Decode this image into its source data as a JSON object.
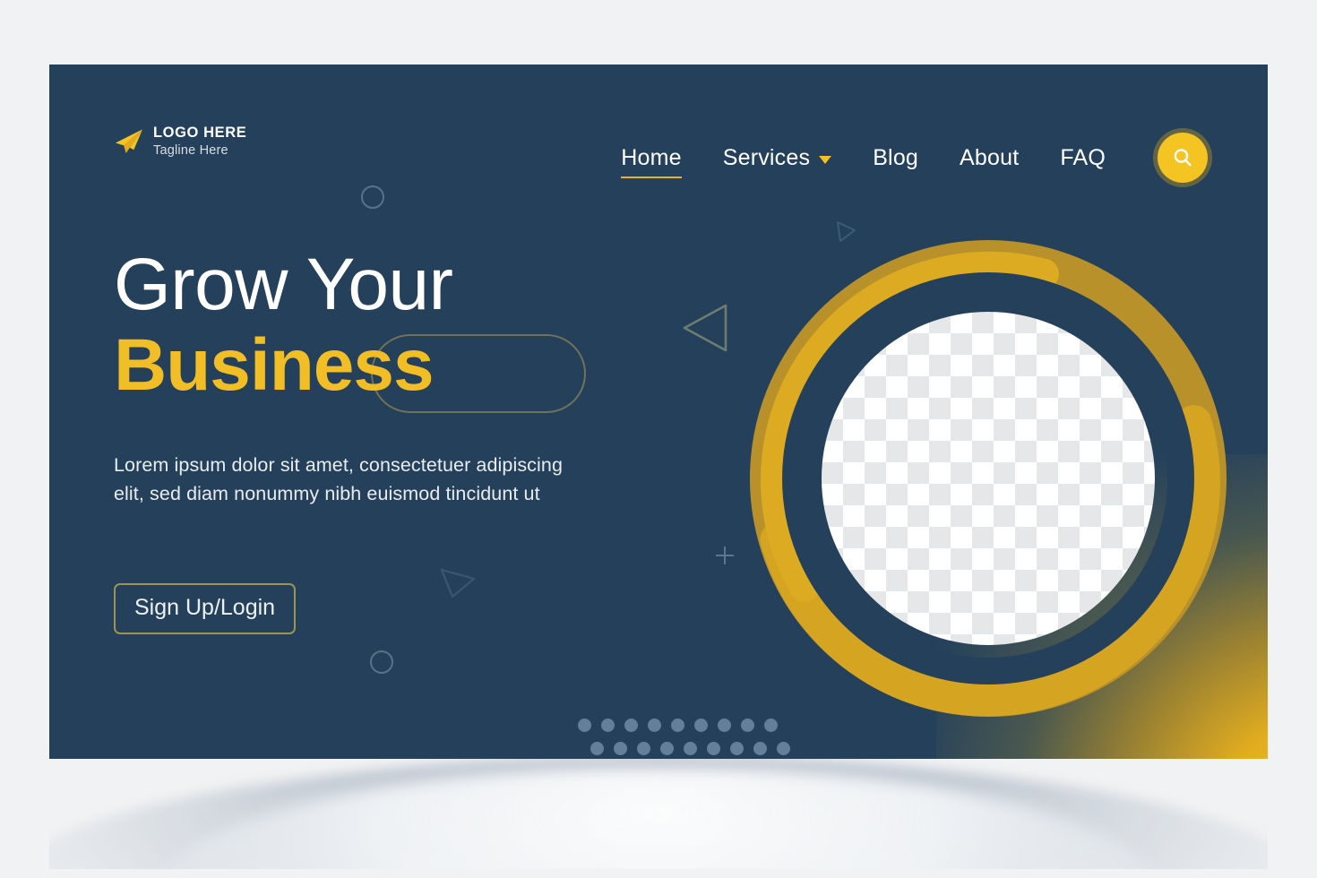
{
  "page": {
    "background_color": "#f1f2f3",
    "banner_color": "#24405a",
    "accent_yellow": "#f2be26",
    "accent_gold": "#b8912a",
    "text_light": "#ffffff"
  },
  "brand": {
    "icon": "paper-plane-icon",
    "title": "LOGO HERE",
    "tagline": "Tagline Here"
  },
  "nav": {
    "items": [
      {
        "label": "Home",
        "active": true,
        "caret": false
      },
      {
        "label": "Services",
        "active": false,
        "caret": true
      },
      {
        "label": "Blog",
        "active": false,
        "caret": false
      },
      {
        "label": "About",
        "active": false,
        "caret": false
      },
      {
        "label": "FAQ",
        "active": false,
        "caret": false
      }
    ],
    "search_icon": "search-icon"
  },
  "hero": {
    "headline_line1": "Grow Your",
    "headline_line2": "Business",
    "body": "Lorem ipsum dolor sit amet, consectetuer adipiscing elit, sed diam nonummy nibh euismod tincidunt ut",
    "cta_label": "Sign Up/Login"
  },
  "media": {
    "placeholder": "image-placeholder-checkerboard",
    "ring_outer_color": "#b8912a",
    "ring_highlight_color": "#dcab21",
    "ring_inner_color": "#24405a"
  },
  "decorations": {
    "circle_count": 2,
    "triangle_count": 3,
    "plus_count": 1,
    "dot_rows": 2,
    "dots_per_row": 9
  }
}
